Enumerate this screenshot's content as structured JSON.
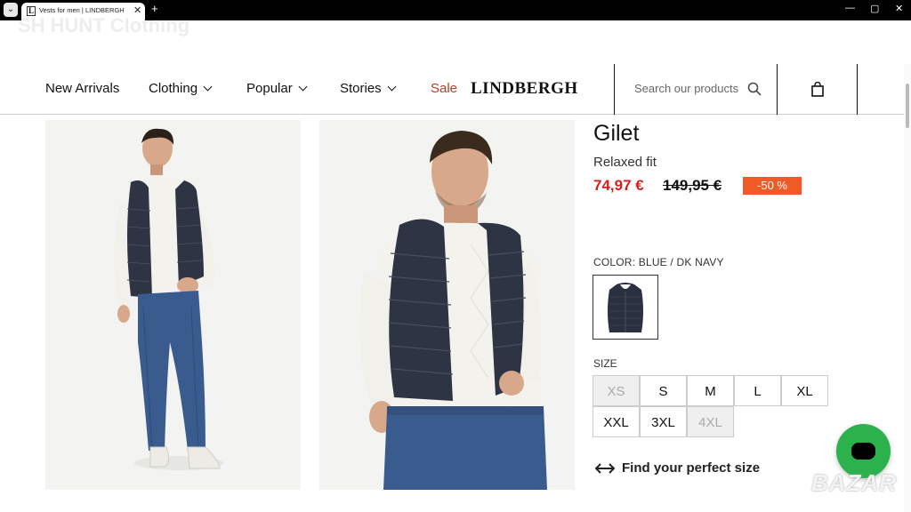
{
  "browser": {
    "tab_title": "Vests for men | LINDBERGH",
    "tab_favicon": "L",
    "close": "✕",
    "new_tab": "+",
    "menu": "⌄",
    "controls": [
      "—",
      "▢",
      "✕"
    ]
  },
  "watermark": "SH HUNT Clothing",
  "nav": {
    "items": [
      "New Arrivals",
      "Clothing",
      "Popular",
      "Stories"
    ],
    "sale": "Sale",
    "logo": "LINDBERGH",
    "search_placeholder": "Search our products"
  },
  "product": {
    "title": "Gilet",
    "fit": "Relaxed fit",
    "price": "74,97 €",
    "old_price": "149,95 €",
    "discount": "-50 %",
    "color_label": "COLOR: BLUE / DK NAVY",
    "size_label": "SIZE",
    "sizes": [
      {
        "label": "XS",
        "available": false
      },
      {
        "label": "S",
        "available": true
      },
      {
        "label": "M",
        "available": true
      },
      {
        "label": "L",
        "available": true
      },
      {
        "label": "XL",
        "available": true
      },
      {
        "label": "XXL",
        "available": true
      },
      {
        "label": "3XL",
        "available": true
      },
      {
        "label": "4XL",
        "available": false
      }
    ],
    "size_guide": "Find your perfect size"
  },
  "overlay": {
    "bazar": "BAZAR"
  },
  "colors": {
    "sale_red": "#d3201d",
    "badge": "#f15a24",
    "chat_green": "#2bb24c",
    "navy": "#2b3040"
  }
}
